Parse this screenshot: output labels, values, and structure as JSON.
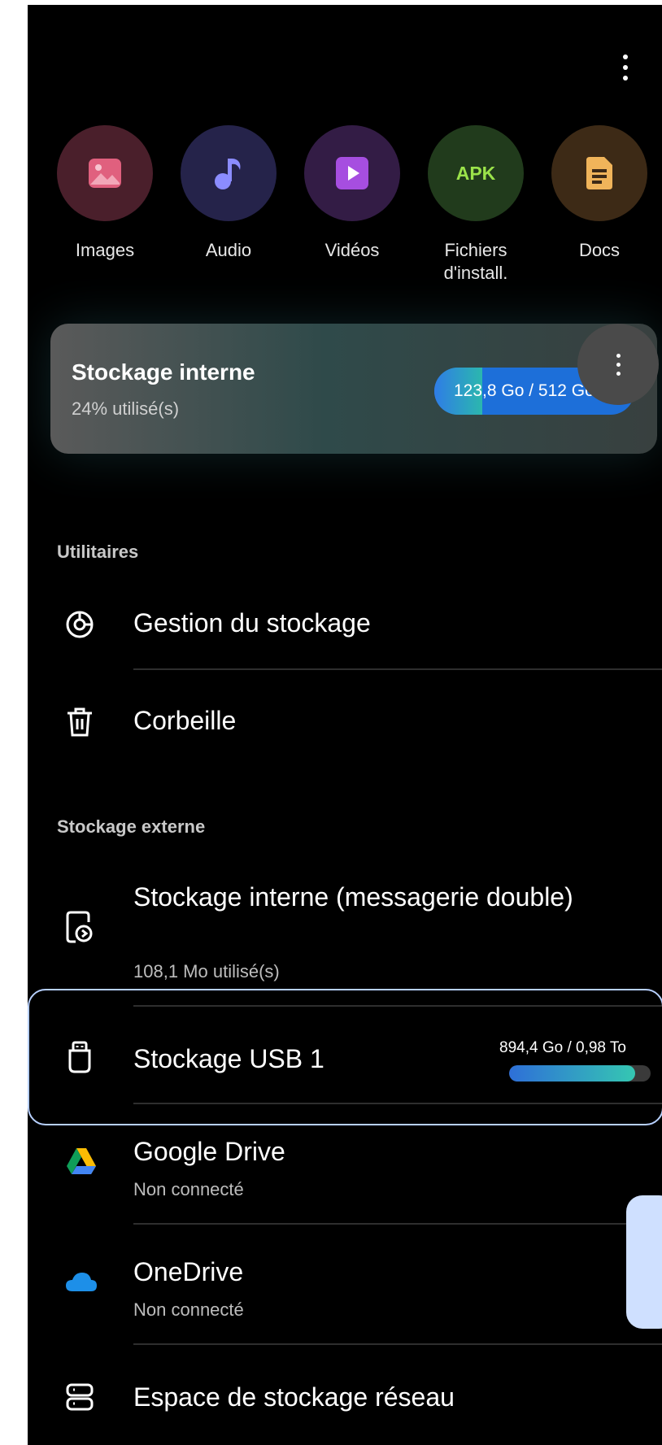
{
  "header": {
    "more_label": "Plus d'options"
  },
  "categories": [
    {
      "label": "Images",
      "icon": "image-icon",
      "bg": "#4a1f2b",
      "accent": "#e0607e"
    },
    {
      "label": "Audio",
      "icon": "music-note-icon",
      "bg": "#25234a",
      "accent": "#8b8cff"
    },
    {
      "label": "Vidéos",
      "icon": "play-icon",
      "bg": "#331c45",
      "accent": "#a64ee0"
    },
    {
      "label": "Fichiers\nd'install.",
      "icon": "apk-icon",
      "bg": "#213b1c",
      "accent": "#9be34a",
      "badge": "APK"
    },
    {
      "label": "Docs",
      "icon": "document-icon",
      "bg": "#3d2a16",
      "accent": "#f0b45a"
    }
  ],
  "internal_storage": {
    "title": "Stockage interne",
    "subtitle": "24% utilisé(s)",
    "used": "123,8 Go",
    "total": " / 512 Go",
    "used_fraction": 0.24
  },
  "utilities": {
    "heading": "Utilitaires",
    "items": [
      {
        "title": "Gestion du stockage",
        "icon": "storage-analysis-icon"
      },
      {
        "title": "Corbeille",
        "icon": "trash-icon"
      }
    ]
  },
  "external": {
    "heading": "Stockage externe",
    "dual_messenger": {
      "title": "Stockage interne (messagerie double)",
      "subtitle": "108,1 Mo utilisé(s)"
    },
    "usb": {
      "title": "Stockage USB 1",
      "capacity": "894,4 Go / 0,98 To",
      "used_fraction": 0.89
    },
    "google_drive": {
      "title": "Google Drive",
      "subtitle": "Non connecté"
    },
    "onedrive": {
      "title": "OneDrive",
      "subtitle": "Non connecté"
    },
    "network": {
      "title": "Espace de stockage réseau"
    }
  }
}
